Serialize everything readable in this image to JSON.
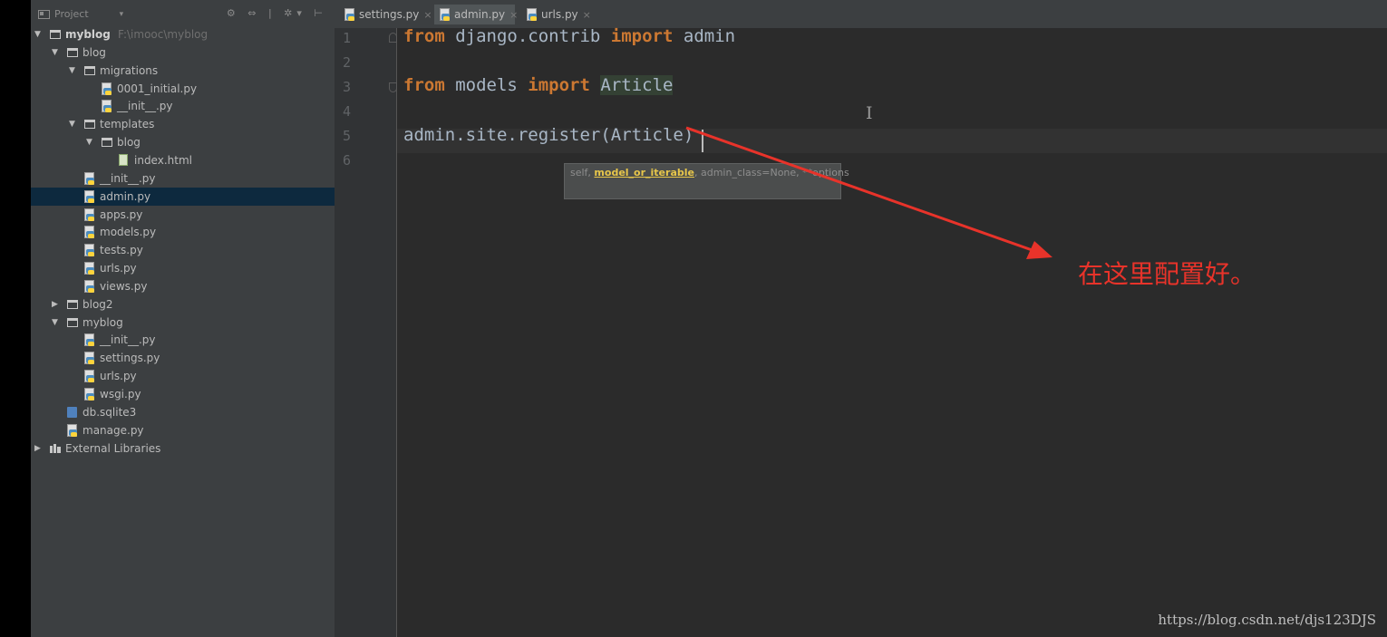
{
  "sidebar": {
    "title": "Project",
    "dropdown_glyph": "▾",
    "tools": "⚙ ⇔ | ✲▾ ⊢",
    "items": [
      {
        "label": "myblog",
        "path": "F:\\imooc\\myblog",
        "icon": "folder-icon",
        "expanded": true
      },
      {
        "label": "blog",
        "icon": "folder-icon",
        "expanded": true
      },
      {
        "label": "migrations",
        "icon": "folder-icon",
        "expanded": true
      },
      {
        "label": "0001_initial.py",
        "icon": "python-file-icon"
      },
      {
        "label": "__init__.py",
        "icon": "python-file-icon"
      },
      {
        "label": "templates",
        "icon": "folder-icon",
        "expanded": true
      },
      {
        "label": "blog",
        "icon": "folder-icon",
        "expanded": true
      },
      {
        "label": "index.html",
        "icon": "html-file-icon"
      },
      {
        "label": "__init__.py",
        "icon": "python-file-icon"
      },
      {
        "label": "admin.py",
        "icon": "python-file-icon",
        "selected": true
      },
      {
        "label": "apps.py",
        "icon": "python-file-icon"
      },
      {
        "label": "models.py",
        "icon": "python-file-icon"
      },
      {
        "label": "tests.py",
        "icon": "python-file-icon"
      },
      {
        "label": "urls.py",
        "icon": "python-file-icon"
      },
      {
        "label": "views.py",
        "icon": "python-file-icon"
      },
      {
        "label": "blog2",
        "icon": "folder-icon",
        "expanded": false
      },
      {
        "label": "myblog",
        "icon": "folder-icon",
        "expanded": true
      },
      {
        "label": "__init__.py",
        "icon": "python-file-icon"
      },
      {
        "label": "settings.py",
        "icon": "python-file-icon"
      },
      {
        "label": "urls.py",
        "icon": "python-file-icon"
      },
      {
        "label": "wsgi.py",
        "icon": "python-file-icon"
      },
      {
        "label": "db.sqlite3",
        "icon": "database-icon"
      },
      {
        "label": "manage.py",
        "icon": "python-file-icon"
      },
      {
        "label": "External Libraries",
        "icon": "library-icon",
        "expanded": false
      }
    ]
  },
  "tabs": [
    {
      "label": "settings.py",
      "close": "×"
    },
    {
      "label": "admin.py",
      "close": "×",
      "active": true
    },
    {
      "label": "urls.py",
      "close": "×"
    }
  ],
  "editor": {
    "line_numbers": [
      "1",
      "2",
      "3",
      "4",
      "5",
      "6"
    ],
    "lines": [
      {
        "kw1": "from",
        "mod": " django.contrib ",
        "kw2": "import",
        "name": " admin"
      },
      {
        "kw1": "from",
        "mod": " models ",
        "kw2": "import",
        "name": "Article"
      },
      {
        "call_pre": "admin.site.register(",
        "arg": "Article",
        "call_post": ")"
      }
    ],
    "tooltip": {
      "pre": "self, ",
      "highlight": "model_or_iterable",
      "post": ", admin_class=None, **options"
    }
  },
  "annotation": {
    "text": "在这里配置好。",
    "color": "#e8332a"
  },
  "watermark": "https://blog.csdn.net/djs123DJS",
  "colors": {
    "keyword": "#cc7832",
    "code": "#a9b7c6",
    "selection": "#0d293e",
    "editor_bg": "#2b2b2b",
    "sidebar_bg": "#3c3f41"
  }
}
